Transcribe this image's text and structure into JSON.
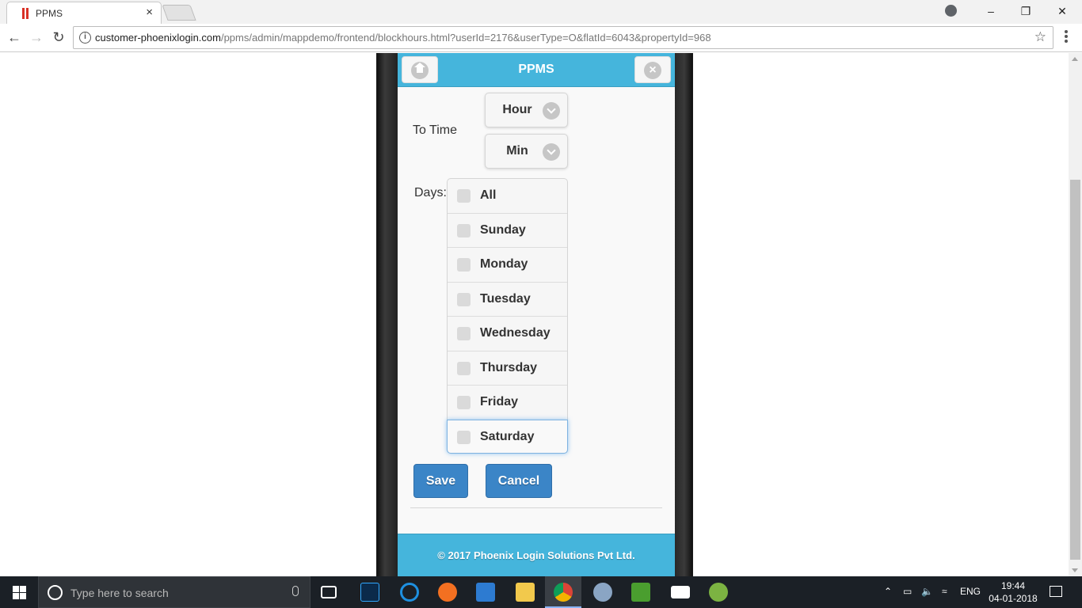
{
  "browser": {
    "tab_title": "PPMS",
    "tab_close": "×",
    "url_domain": "customer-phoenixlogin.com",
    "url_path": "/ppms/admin/mappdemo/frontend/blockhours.html?userId=2176&userType=O&flatId=6043&propertyId=968"
  },
  "app": {
    "header_title": "PPMS",
    "to_time_label": "To Time",
    "hour_select": "Hour",
    "min_select": "Min",
    "days_label": "Days:",
    "days": [
      "All",
      "Sunday",
      "Monday",
      "Tuesday",
      "Wednesday",
      "Thursday",
      "Friday",
      "Saturday"
    ],
    "save_label": "Save",
    "cancel_label": "Cancel",
    "footer": "© 2017 Phoenix Login Solutions Pvt Ltd."
  },
  "taskbar": {
    "search_placeholder": "Type here to search",
    "language": "ENG",
    "time": "19:44",
    "date": "04-01-2018"
  },
  "colors": {
    "header": "#45b5dc",
    "button": "#3b85c7",
    "taskbar": "#1b2026"
  }
}
